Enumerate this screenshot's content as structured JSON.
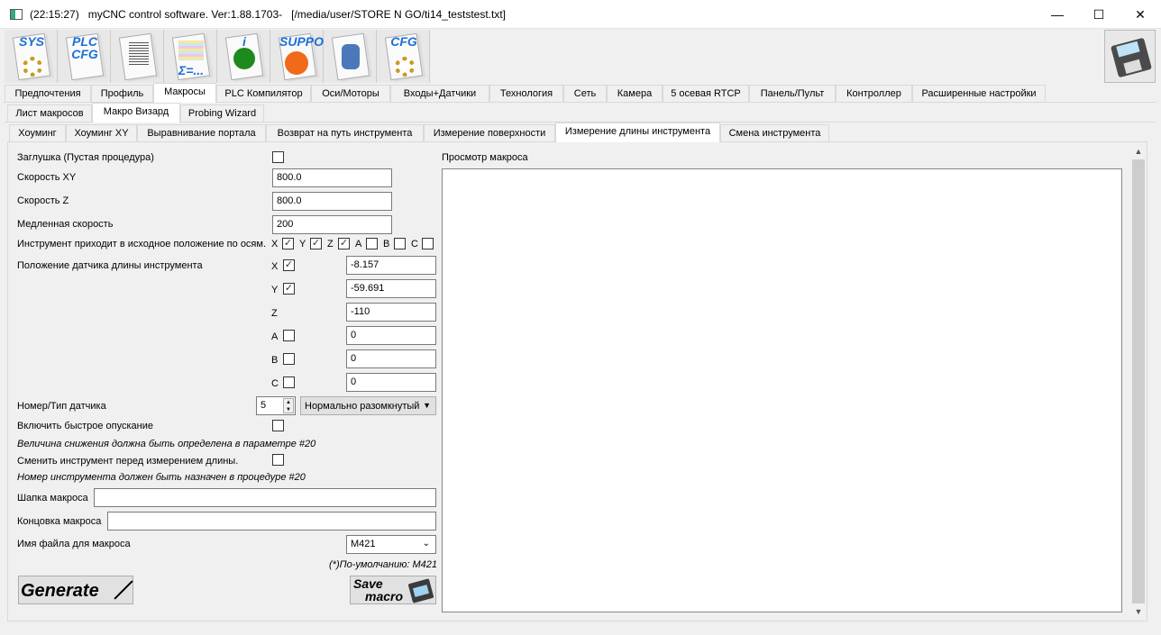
{
  "window": {
    "title": "(22:15:27)   myCNC control software. Ver:1.88.1703-   [/media/user/STORE N GO/ti14_teststest.txt]",
    "minimize": "—",
    "maximize": "☐",
    "close": "✕"
  },
  "toolbar": [
    {
      "name": "sys",
      "label": "SYS"
    },
    {
      "name": "plc-cfg",
      "label": "PLC CFG"
    },
    {
      "name": "document",
      "label": ""
    },
    {
      "name": "formula",
      "label": "Σ=..."
    },
    {
      "name": "info",
      "label": "i"
    },
    {
      "name": "support",
      "label": "SUPPORT"
    },
    {
      "name": "database",
      "label": ""
    },
    {
      "name": "cfg",
      "label": "CFG"
    }
  ],
  "main_tabs": [
    "Предпочтения",
    "Профиль",
    "Макросы",
    "PLC Компилятор",
    "Оси/Моторы",
    "Входы+Датчики",
    "Технология",
    "Сеть",
    "Камера",
    "5 осевая RTCP",
    "Панель/Пульт",
    "Контроллер",
    "Расширенные настройки"
  ],
  "sub_tabs": [
    "Лист макросов",
    "Макро Визард",
    "Probing Wizard"
  ],
  "wizard_tabs": [
    "Хоуминг",
    "Хоуминг XY",
    "Выравнивание портала",
    "Возврат на путь инструмента",
    "Измерение поверхности",
    "Измерение длины инструмента",
    "Смена инструмента"
  ],
  "form": {
    "dummy_label": "Заглушка (Пустая процедура)",
    "speed_xy_label": "Скорость XY",
    "speed_xy": "800.0",
    "speed_z_label": "Скорость Z",
    "speed_z": "800.0",
    "slow_speed_label": "Медленная скорость",
    "slow_speed": "200",
    "home_axes_label": "Инструмент приходит в исходное положение по осям.",
    "home_axes": [
      {
        "axis": "X",
        "checked": true
      },
      {
        "axis": "Y",
        "checked": true
      },
      {
        "axis": "Z",
        "checked": true
      },
      {
        "axis": "A",
        "checked": false
      },
      {
        "axis": "B",
        "checked": false
      },
      {
        "axis": "C",
        "checked": false
      }
    ],
    "sensor_pos_label": "Положение датчика длины инструмента",
    "sensor_pos": [
      {
        "axis": "X",
        "checked": true,
        "value": "-8.157"
      },
      {
        "axis": "Y",
        "checked": true,
        "value": "-59.691"
      },
      {
        "axis": "Z",
        "value": "-110"
      },
      {
        "axis": "A",
        "checked": false,
        "value": "0"
      },
      {
        "axis": "B",
        "checked": false,
        "value": "0"
      },
      {
        "axis": "C",
        "checked": false,
        "value": "0"
      }
    ],
    "sensor_type_label": "Номер/Тип датчика",
    "sensor_number": "5",
    "sensor_type": "Нормально разомкнутый",
    "fast_descent_label": "Включить быстрое опускание",
    "fast_descent_note": "Величина снижения должна быть определена в параметре #20",
    "change_tool_label": "Сменить инструмент перед измерением длины.",
    "change_tool_note": "Номер инструмента должен быть назначен в процедуре #20",
    "header_label": "Шапка макроса",
    "header_value": "",
    "footer_label": "Концовка макроса",
    "footer_value": "",
    "filename_label": "Имя файла для макроса",
    "filename": "M421",
    "default_note": "(*)По-умолчанию: M421",
    "generate": "Generate",
    "save_line1": "Save",
    "save_line2": "macro"
  },
  "preview_label": "Просмотр макроса"
}
